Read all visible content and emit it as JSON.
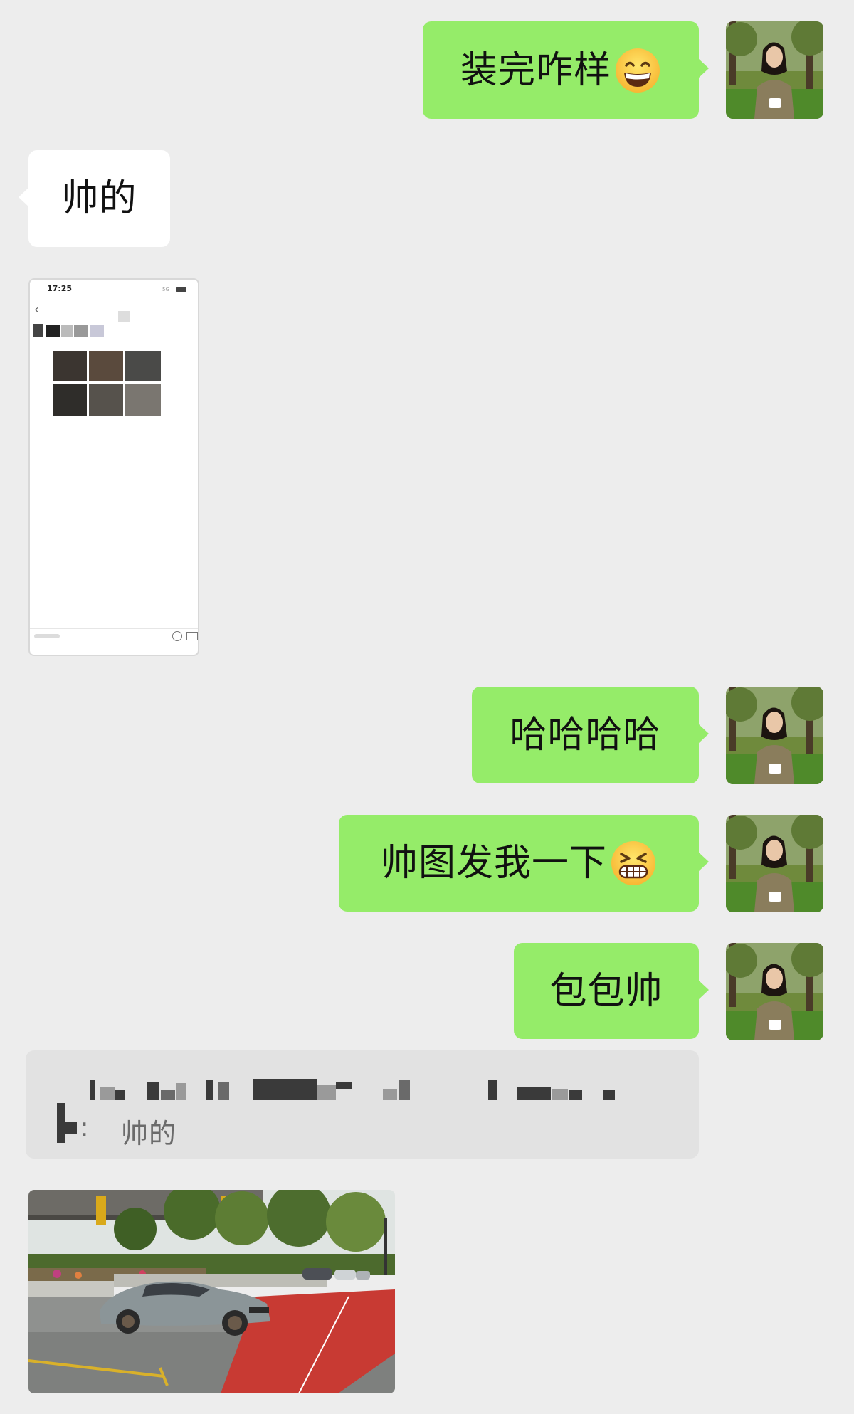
{
  "conversation": {
    "messages": [
      {
        "side": "me",
        "text": "装完咋样",
        "emoji": "grinning-face-emoji"
      },
      {
        "side": "other",
        "text": "帅的"
      },
      {
        "side": "other",
        "type": "image",
        "content": "phone-screenshot"
      },
      {
        "side": "me",
        "text": "哈哈哈哈"
      },
      {
        "side": "me",
        "text": "帅图发我一下",
        "emoji": "grinning-squinting-face-emoji"
      },
      {
        "side": "me",
        "text": "包包帅"
      },
      {
        "side": "other",
        "type": "quote",
        "quoted_text": "帅的",
        "quoted_prefix": ":"
      },
      {
        "side": "other",
        "type": "image",
        "content": "car-photo"
      }
    ]
  },
  "screenshot_thumb": {
    "status_time": "17:25",
    "status_signal": "5G"
  },
  "colors": {
    "background": "#ededed",
    "my_bubble": "#95ec69",
    "other_bubble": "#ffffff",
    "quote_bg": "#e2e2e2"
  },
  "icons": {
    "avatar": "avatar-photo",
    "emoji_1": "grinning-face-emoji",
    "emoji_2": "grinning-squinting-face-emoji"
  }
}
